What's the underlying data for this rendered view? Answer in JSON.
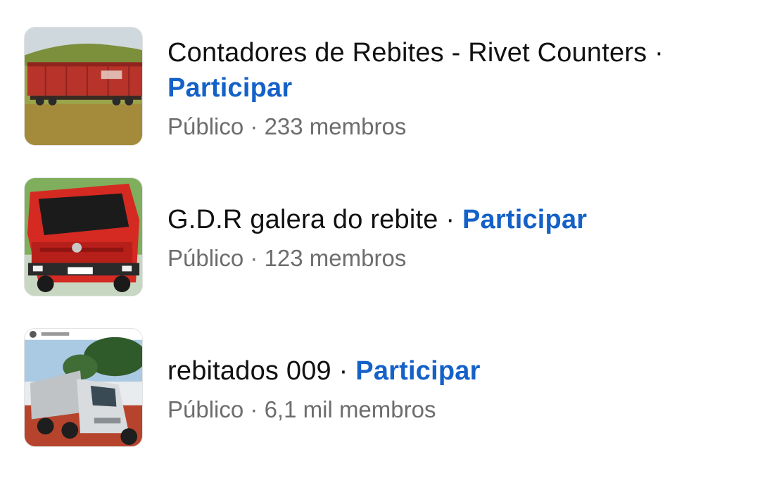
{
  "groups": [
    {
      "name": "Contadores de Rebites - Rivet Counters",
      "join_label": "Participar",
      "privacy": "Público",
      "members": "233 membros",
      "thumbnail": "red-train-wagon-photo"
    },
    {
      "name": "G.D.R galera do rebite",
      "join_label": "Participar",
      "privacy": "Público",
      "members": "123 membros",
      "thumbnail": "red-truck-photo"
    },
    {
      "name": "rebitados 009",
      "join_label": "Participar",
      "privacy": "Público",
      "members": "6,1 mil membros",
      "thumbnail": "white-dump-truck-photo"
    }
  ],
  "separator": "·",
  "colors": {
    "link": "#1461c8",
    "text": "#111111",
    "muted": "#6d6d6d"
  }
}
